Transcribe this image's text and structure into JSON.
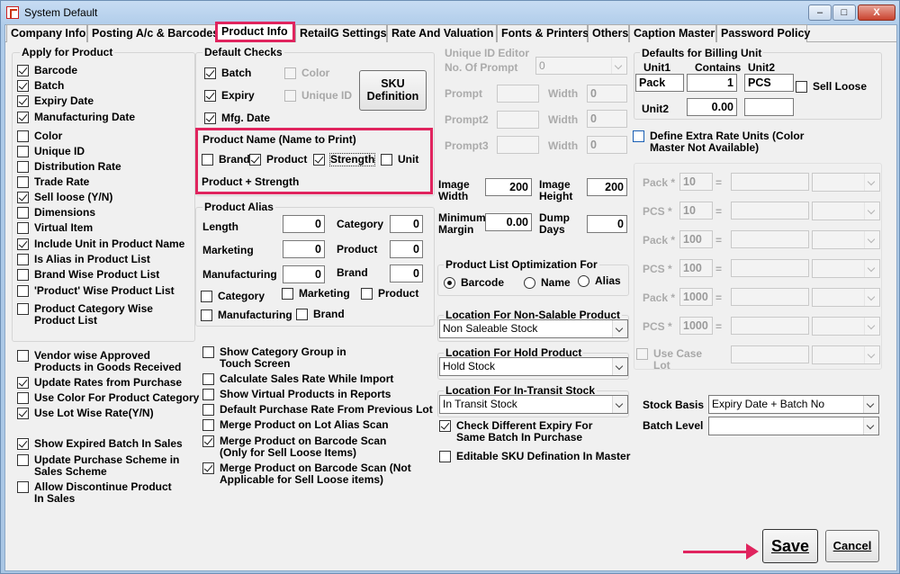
{
  "window": {
    "title": "System Default",
    "min": "–",
    "max": "□",
    "close": "X"
  },
  "tabs": [
    "Company Info",
    "Posting A/c & Barcodes",
    "Product Info",
    "RetailG Settings",
    "Rate And Valuation",
    "Fonts & Printers",
    "Others",
    "Caption Master",
    "Password Policy"
  ],
  "apply": {
    "title": "Apply for Product",
    "items": [
      {
        "label": "Barcode"
      },
      {
        "label": "Batch"
      },
      {
        "label": "Expiry Date"
      },
      {
        "label": "Manufacturing Date"
      },
      {
        "label": "Color"
      },
      {
        "label": "Unique ID"
      },
      {
        "label": "Distribution Rate"
      },
      {
        "label": "Trade Rate"
      },
      {
        "label": "Sell loose (Y/N)"
      },
      {
        "label": "Dimensions"
      },
      {
        "label": "Virtual Item"
      },
      {
        "label": "Include Unit in Product Name"
      },
      {
        "label": "Is Alias in Product List"
      },
      {
        "label": "Brand Wise Product List"
      },
      {
        "label": "'Product' Wise Product List"
      },
      {
        "label": "Product Category Wise Product List"
      }
    ]
  },
  "left_opts": [
    {
      "label": "Vendor wise Approved Products in Goods Received"
    },
    {
      "label": "Update Rates from Purchase"
    },
    {
      "label": "Use Color For Product Category"
    },
    {
      "label": "Use Lot Wise Rate(Y/N)"
    },
    {
      "label": "Show Expired Batch In Sales"
    },
    {
      "label": "Update Purchase Scheme in Sales Scheme"
    },
    {
      "label": "Allow Discontinue Product In Sales"
    }
  ],
  "default_checks": {
    "title": "Default Checks",
    "batch": "Batch",
    "color": "Color",
    "expiry": "Expiry",
    "unique_id": "Unique ID",
    "mfg": "Mfg. Date",
    "sku_button": "SKU Definition"
  },
  "product_name": {
    "title": "Product Name (Name to Print)",
    "brand": "Brand",
    "product": "Product",
    "strength": "Strength",
    "unit": "Unit",
    "preview": "Product + Strength"
  },
  "alias": {
    "title": "Product Alias",
    "length": "Length",
    "length_val": "0",
    "category": "Category",
    "category_val": "0",
    "marketing": "Marketing",
    "marketing_val": "0",
    "product": "Product",
    "product_val": "0",
    "manufacturing": "Manufacturing",
    "manufacturing_val": "0",
    "brand": "Brand",
    "brand_val": "0",
    "cb_category": "Category",
    "cb_marketing": "Marketing",
    "cb_product": "Product",
    "cb_manufacturing": "Manufacturing",
    "cb_brand": "Brand"
  },
  "mid_opts": [
    {
      "label": "Show Category Group in Touch Screen"
    },
    {
      "label": "Calculate Sales Rate While Import"
    },
    {
      "label": "Show Virtual Products in Reports"
    },
    {
      "label": "Default Purchase Rate From Previous Lot"
    },
    {
      "label": "Merge Product on Lot Alias Scan"
    },
    {
      "label": "Merge Product on Barcode Scan (Only for Sell Loose Items)"
    },
    {
      "label": "Merge Product on Barcode Scan (Not Applicable for Sell Loose items)"
    }
  ],
  "unique_editor": {
    "title": "Unique ID Editor",
    "no_prompt": "No. Of Prompt",
    "no_prompt_val": "0",
    "prompt": "Prompt",
    "prompt2": "Prompt2",
    "prompt3": "Prompt3",
    "width": "Width",
    "w1": "0",
    "w2": "0",
    "w3": "0"
  },
  "image": {
    "width_label": "Image Width",
    "width_val": "200",
    "height_label": "Image Height",
    "height_val": "200",
    "margin_label": "Minimum Margin",
    "margin_val": "0.00",
    "dump_label": "Dump Days",
    "dump_val": "0"
  },
  "optimization": {
    "title": "Product List Optimization For",
    "barcode": "Barcode",
    "name": "Name",
    "alias": "Alias"
  },
  "locations": {
    "non_salable_title": "Location For Non-Salable Product",
    "non_salable_val": "Non Saleable Stock",
    "hold_title": "Location For Hold Product",
    "hold_val": "Hold Stock",
    "transit_title": "Location For In-Transit Stock",
    "transit_val": "In Transit Stock"
  },
  "check_expiry": "Check Different Expiry For Same Batch In Purchase",
  "editable_sku": "Editable SKU Defination In Master",
  "billing": {
    "title": "Defaults for Billing Unit",
    "unit1": "Unit1",
    "contains": "Contains",
    "unit2": "Unit2",
    "unit1_val": "Pack",
    "contains_val": "1",
    "unit2_val": "PCS",
    "sell_loose": "Sell Loose",
    "unit2_label": "Unit2",
    "unit2_rate": "0.00"
  },
  "extra_rate": {
    "label": "Define Extra Rate Units (Color Master Not Available)"
  },
  "rate_units": [
    {
      "label": "Pack *",
      "val": "10"
    },
    {
      "label": "PCS *",
      "val": "10"
    },
    {
      "label": "Pack *",
      "val": "100"
    },
    {
      "label": "PCS *",
      "val": "100"
    },
    {
      "label": "Pack *",
      "val": "1000"
    },
    {
      "label": "PCS *",
      "val": "1000"
    }
  ],
  "equals": "=",
  "use_case_lot": "Use Case Lot",
  "stock_basis": {
    "label": "Stock Basis",
    "val": "Expiry Date + Batch No"
  },
  "batch_level": {
    "label": "Batch Level",
    "val": ""
  },
  "footer": {
    "save": "Save",
    "cancel": "Cancel"
  },
  "colors": {
    "highlight": "#e0245e",
    "accent": "#1a5fb4"
  }
}
